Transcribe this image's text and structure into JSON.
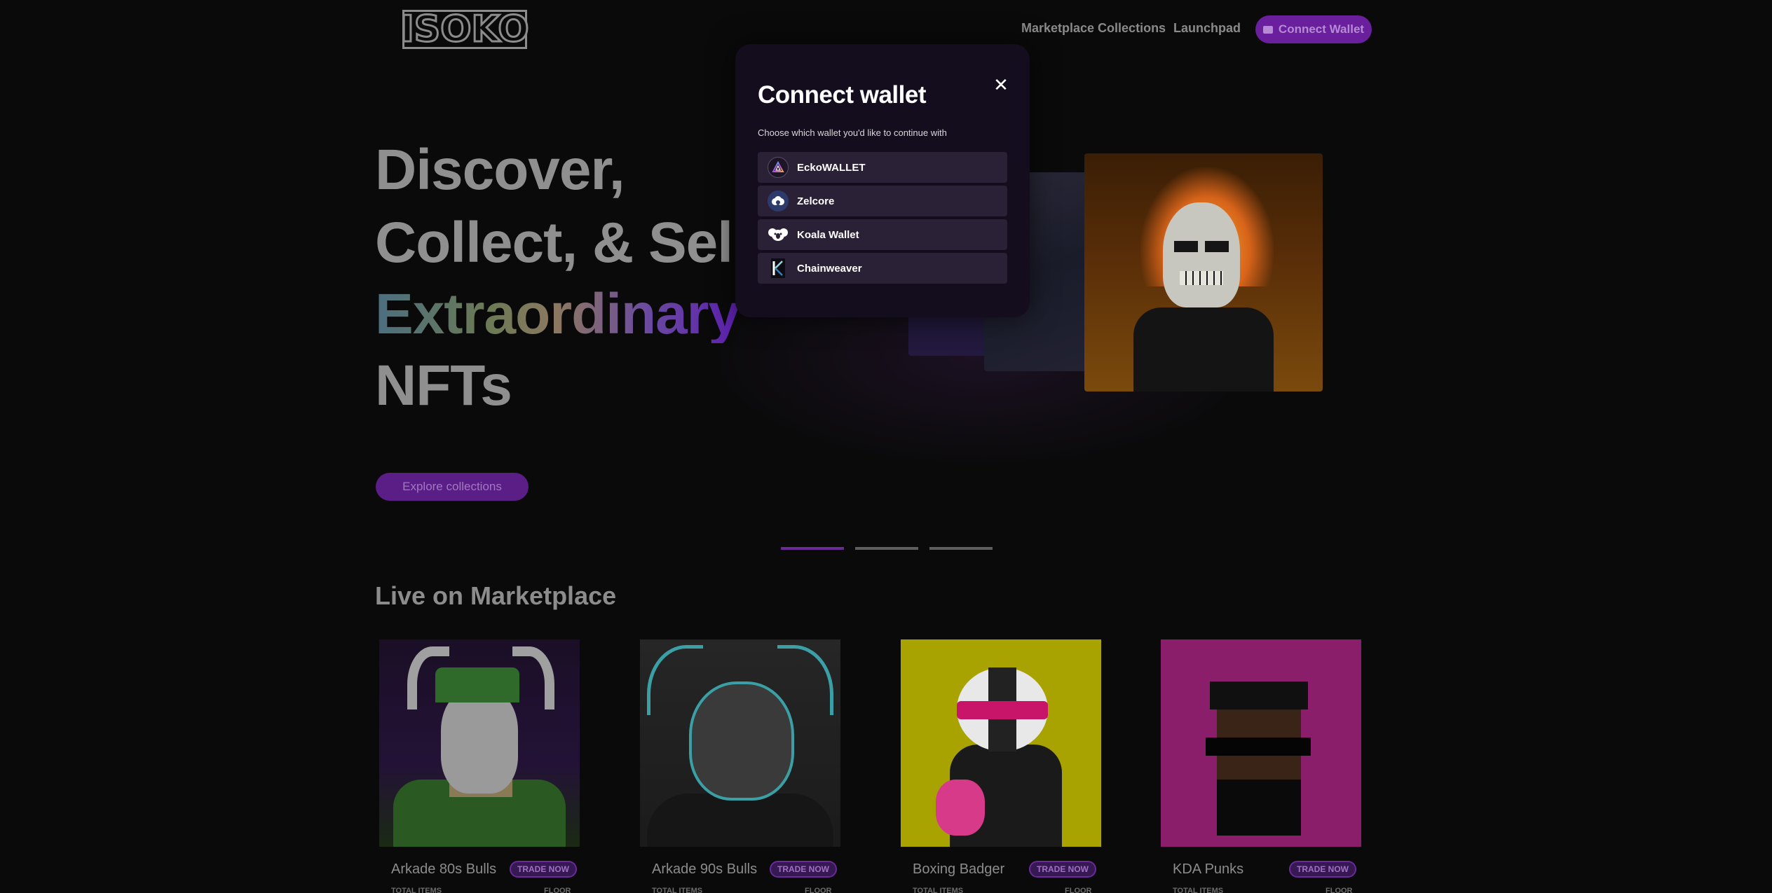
{
  "header": {
    "logo_text": "ISOKO",
    "nav": {
      "marketplace_collections": "Marketplace Collections",
      "launchpad": "Launchpad"
    },
    "connect_wallet_label": "Connect Wallet"
  },
  "hero": {
    "line1": "Discover,",
    "line2": "Collect, & Sell",
    "line3": "Extraordinary",
    "line4": "NFTs",
    "cta_label": "Explore collections"
  },
  "carousel": {
    "slides": 3,
    "active_index": 0
  },
  "marketplace": {
    "title": "Live on Marketplace",
    "trade_label": "TRADE NOW",
    "total_items_label": "TOTAL ITEMS",
    "floor_label": "FLOOR",
    "collections": [
      {
        "name": "Arkade 80s Bulls"
      },
      {
        "name": "Arkade 90s Bulls"
      },
      {
        "name": "Boxing Badger"
      },
      {
        "name": "KDA Punks"
      }
    ]
  },
  "modal": {
    "title": "Connect wallet",
    "subtitle": "Choose which wallet you'd like to continue with",
    "close_symbol": "✕",
    "wallets": [
      {
        "name": "EckoWALLET",
        "icon": "ecko-wallet-icon"
      },
      {
        "name": "Zelcore",
        "icon": "zelcore-icon"
      },
      {
        "name": "Koala Wallet",
        "icon": "koala-wallet-icon"
      },
      {
        "name": "Chainweaver",
        "icon": "chainweaver-icon"
      }
    ]
  },
  "colors": {
    "accent": "#6a1f9c",
    "modal_bg": "#140d1e",
    "wallet_row_bg": "#2a2136",
    "page_bg": "#0a0a0a"
  }
}
